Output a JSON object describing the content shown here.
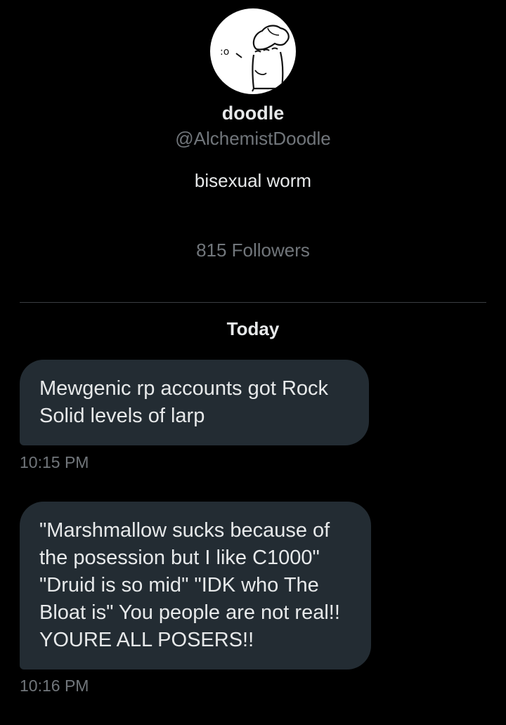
{
  "profile": {
    "avatar_text": ":o",
    "display_name": "doodle",
    "handle": "@AlchemistDoodle",
    "bio": "bisexual worm",
    "followers": "815 Followers"
  },
  "conversation": {
    "date_separator": "Today",
    "messages": [
      {
        "text": "Mewgenic rp accounts got Rock Solid levels of larp",
        "time": "10:15 PM"
      },
      {
        "text": "\"Marshmallow sucks because of the posession but I like C1000\" \"Druid is so mid\" \"IDK who The Bloat is\" You people are not real!! YOURE ALL POSERS!!",
        "time": "10:16 PM"
      }
    ]
  },
  "colors": {
    "background": "#000000",
    "bubble": "#232c33",
    "primary_text": "#e7e9ea",
    "secondary_text": "#71767b",
    "divider": "#3a3e42"
  }
}
